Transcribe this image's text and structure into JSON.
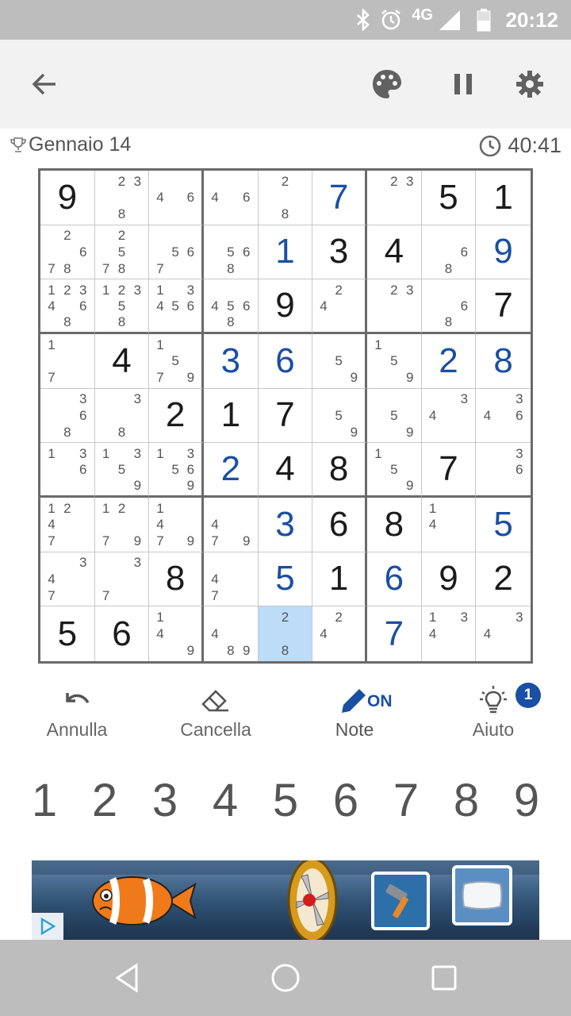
{
  "status_bar": {
    "time": "20:12",
    "network": "4G",
    "icons": [
      "bluetooth-icon",
      "alarm-icon",
      "signal-icon",
      "battery-icon"
    ]
  },
  "toolbar": {
    "icons": [
      "back-arrow-icon",
      "palette-icon",
      "pause-icon",
      "gear-icon"
    ]
  },
  "game_info": {
    "date": "Gennaio 14",
    "timer": "40:41"
  },
  "board": {
    "selected_cell": [
      8,
      4
    ],
    "rows": [
      [
        "9",
        "2 3 8",
        "4 6",
        "4 6",
        "2 8",
        "u7",
        "2 3",
        "5",
        "1"
      ],
      [
        "2 6 7 8",
        "2 5 7 8",
        "5 6 7",
        "5 6 8",
        "u1",
        "3",
        "4",
        "6 8",
        "u9"
      ],
      [
        "1 2 3 4 6 8",
        "1 2 3 5 8",
        "1 3 4 5 6",
        "4 5 6 8",
        "9",
        "2 4",
        "2 3",
        "6 8",
        "7"
      ],
      [
        "1 7",
        "4",
        "1 5 7 9",
        "u3",
        "u6",
        "5 9",
        "1 5 9",
        "u2",
        "u8"
      ],
      [
        "3 6 8",
        "3 8",
        "2",
        "1",
        "7",
        "5 9",
        "5 9",
        "3 4",
        "3 4 6"
      ],
      [
        "1 3 6",
        "1 3 5 9",
        "1 3 5 6 9",
        "u2",
        "4",
        "8",
        "1 5 9",
        "7",
        "3 6"
      ],
      [
        "1 2 4 7",
        "1 2 7 9",
        "1 4 7 9",
        "4 7 9",
        "u3",
        "6",
        "8",
        "1 4",
        "u5"
      ],
      [
        "3 4 7",
        "3 7",
        "8",
        "4 7",
        "u5",
        "1",
        "u6",
        "9",
        "2"
      ],
      [
        "5",
        "6",
        "1 4 9",
        "4 8 9",
        "2 8",
        "2 4",
        "u7",
        "1 3 4",
        "3 4"
      ]
    ]
  },
  "actions": {
    "undo": {
      "label": "Annulla",
      "icon": "undo-icon"
    },
    "erase": {
      "label": "Cancella",
      "icon": "eraser-icon"
    },
    "notes": {
      "label": "Note",
      "state": "ON",
      "icon": "pencil-icon"
    },
    "hint": {
      "label": "Aiuto",
      "count": "1",
      "icon": "lightbulb-icon"
    }
  },
  "numpad": [
    "1",
    "2",
    "3",
    "4",
    "5",
    "6",
    "7",
    "8",
    "9"
  ],
  "ad": {
    "icons": [
      "clownfish-icon",
      "propeller-icon",
      "hammer-icon",
      "pillow-icon",
      "ad-choices-icon"
    ]
  },
  "nav_bar": {
    "icons": [
      "back-triangle-icon",
      "home-circle-icon",
      "recents-square-icon"
    ]
  },
  "colors": {
    "accent_blue": "#1a4fa3",
    "selected_cell": "#bcdcf8",
    "status_bar": "#bdbdbd",
    "toolbar_bg": "#f2f2f2"
  }
}
